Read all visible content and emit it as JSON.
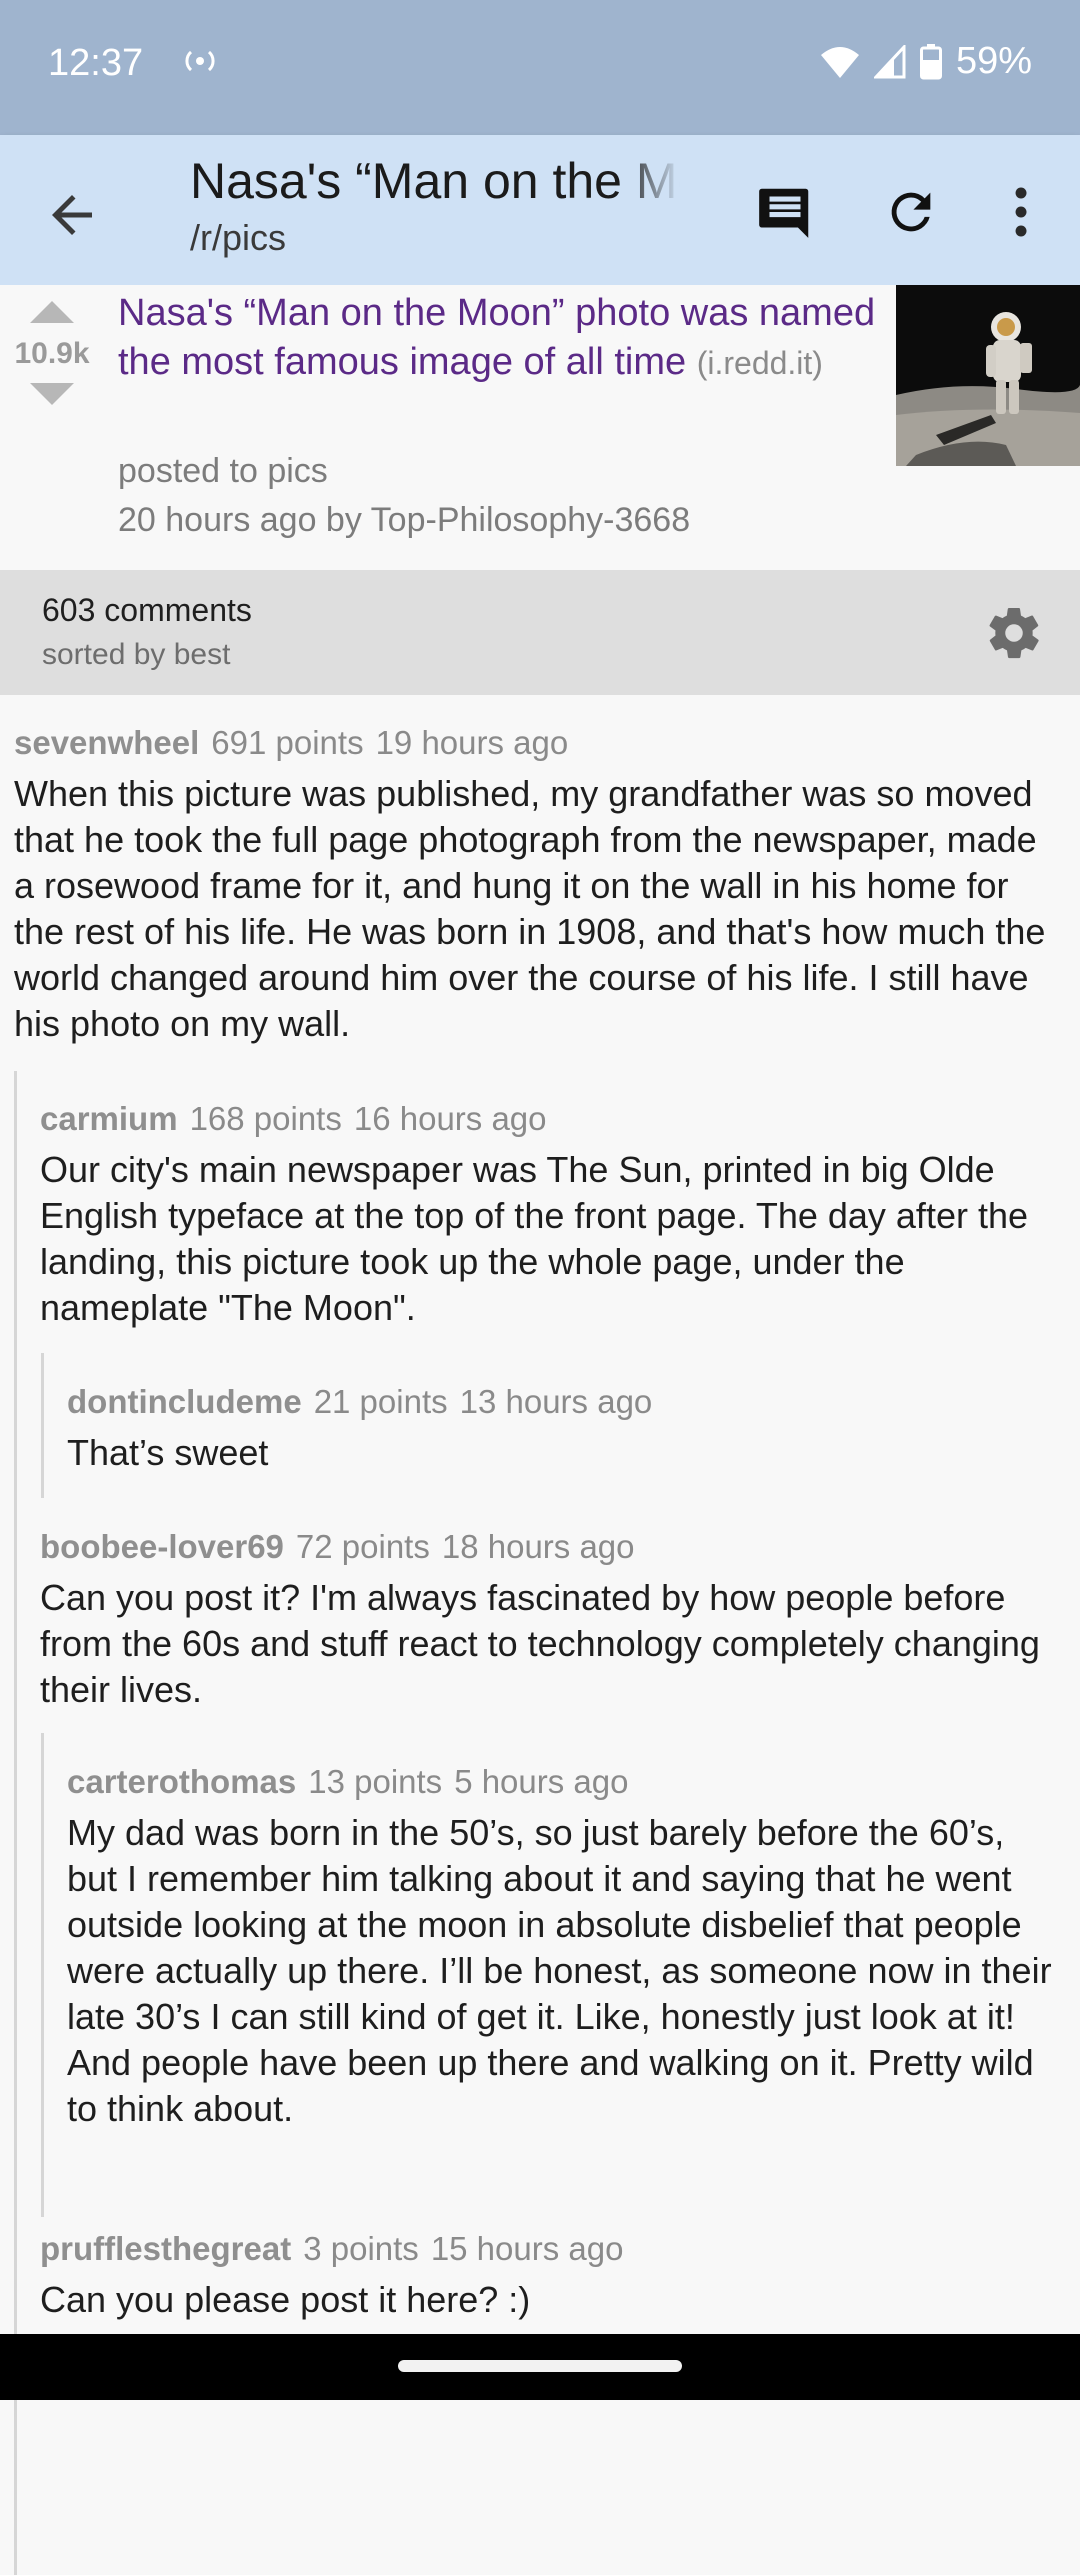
{
  "status_bar": {
    "time": "12:37",
    "cast_icon": "radio-signal",
    "battery_percent": "59%"
  },
  "app_bar": {
    "title": "Nasa's “Man on the Moon” photo was named the most famous image of all time",
    "subtitle": "/r/pics",
    "icons": [
      "arrow-back-icon",
      "comment-icon",
      "refresh-icon",
      "more-vert-icon"
    ]
  },
  "post": {
    "score": "10.9k",
    "title": "Nasa's “Man on the Moon” photo was named the most famous image of all time",
    "domain": "(i.redd.it)",
    "posted_to": "posted to pics",
    "byline": "20 hours ago by Top-Philosophy-3668"
  },
  "comments_header": {
    "count": "603 comments",
    "sort": "sorted by best"
  },
  "comments": [
    {
      "author": "sevenwheel",
      "points": "691 points",
      "time": "19 hours ago",
      "depth": 0,
      "body": "When this picture was published, my grandfather was so moved that he took the full page photograph from the newspaper, made a rosewood frame for it, and hung it on the wall in his home for the rest of his life. He was born in 1908, and that's how much the world changed around him over the course of his life. I still have his photo on my wall."
    },
    {
      "author": "carmium",
      "points": "168 points",
      "time": "16 hours ago",
      "depth": 1,
      "body": "Our city's main newspaper was The Sun, printed in big Olde English typeface at the top of the front page. The day after the landing, this picture took up the whole page, under the nameplate \"The Moon\"."
    },
    {
      "author": "dontincludeme",
      "points": "21 points",
      "time": "13 hours ago",
      "depth": 2,
      "body": "That’s sweet"
    },
    {
      "author": "boobee-lover69",
      "points": "72 points",
      "time": "18 hours ago",
      "depth": 1,
      "body": "Can you post it? I'm always fascinated by how people before from the 60s and stuff react to technology completely changing their lives."
    },
    {
      "author": "carterothomas",
      "points": "13 points",
      "time": "5 hours ago",
      "depth": 2,
      "body": "My dad was born in the 50’s, so just barely before the 60’s, but I remember him talking about it and saying that he went outside looking at the moon in absolute disbelief that people were actually up there. I’ll be honest, as someone now in their late 30’s I can still kind of get it. Like, honestly just look at it! And people have been up there and walking on it. Pretty wild to think about."
    },
    {
      "author": "prufflesthegreat",
      "points": "3 points",
      "time": "15 hours ago",
      "depth": 1,
      "body": "Can you please post it here? :)"
    }
  ],
  "colors": {
    "status_bar": "#9fb4ce",
    "app_bar": "#cfe1f5",
    "post_title": "#5b2a87",
    "comments_header": "#dedede"
  }
}
